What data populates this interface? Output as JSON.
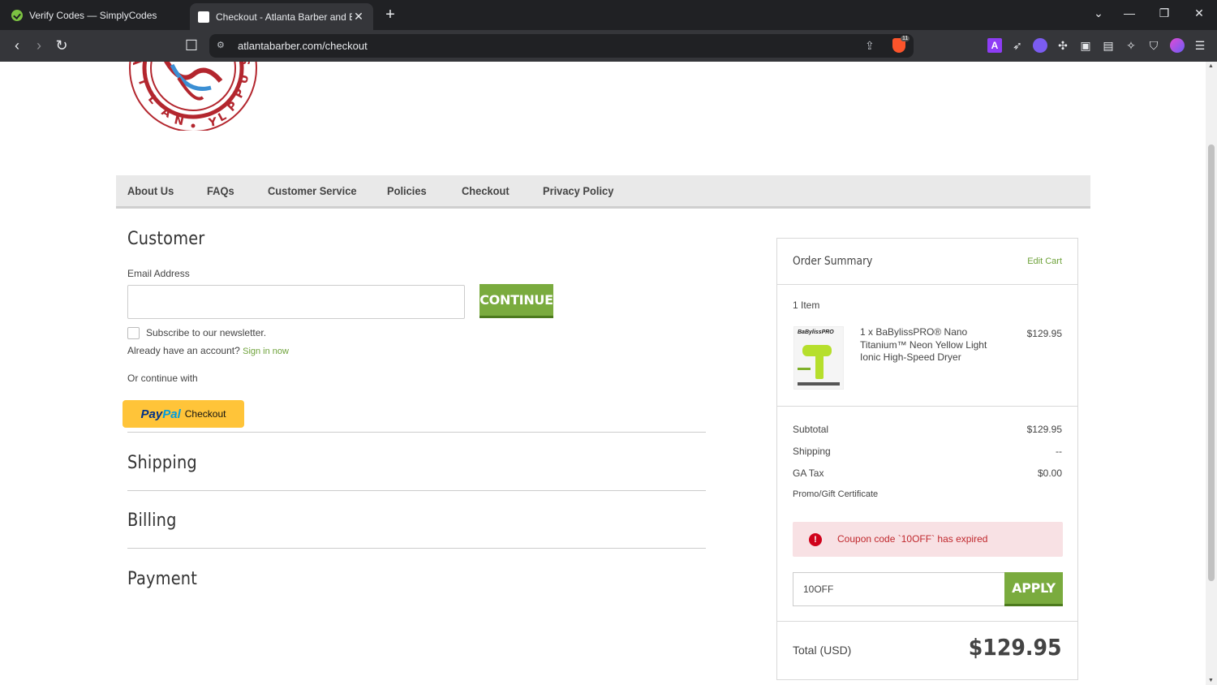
{
  "browser": {
    "tabs": [
      {
        "title": "Verify Codes — SimplyCodes"
      },
      {
        "title": "Checkout - Atlanta Barber and B"
      }
    ],
    "url": "atlantabarber.com/checkout",
    "brave_badge": "11"
  },
  "nav": {
    "items": [
      "About Us",
      "FAQs",
      "Customer Service",
      "Policies",
      "Checkout",
      "Privacy Policy"
    ]
  },
  "customer": {
    "heading": "Customer",
    "email_label": "Email Address",
    "email_value": "",
    "continue_label": "CONTINUE",
    "newsletter_label": "Subscribe to our newsletter.",
    "have_account": "Already have an account?",
    "sign_in": "Sign in now",
    "continue_with": "Or continue with",
    "paypal_text_1": "Pay",
    "paypal_text_2": "Pal",
    "paypal_checkout": "Checkout"
  },
  "sections": {
    "shipping": "Shipping",
    "billing": "Billing",
    "payment": "Payment"
  },
  "summary": {
    "title": "Order Summary",
    "edit_cart": "Edit Cart",
    "item_count": "1 Item",
    "product_name": "1 x BaBylissPRO® Nano Titanium™ Neon Yellow Light Ionic High-Speed Dryer",
    "product_price": "$129.95",
    "product_brand": "BaBylissPRO",
    "subtotal_label": "Subtotal",
    "subtotal_value": "$129.95",
    "shipping_label": "Shipping",
    "shipping_value": "--",
    "tax_label": "GA Tax",
    "tax_value": "$0.00",
    "promo_label": "Promo/Gift Certificate",
    "alert_msg": "Coupon code `10OFF` has expired",
    "coupon_value": "10OFF",
    "apply_label": "APPLY",
    "total_label": "Total (USD)",
    "total_value": "$129.95"
  },
  "colors": {
    "accent_green": "#7aab3e",
    "link_green": "#6ea23a",
    "paypal_yellow": "#ffc439",
    "alert_bg": "#f8e1e4",
    "alert_text": "#c0282d"
  }
}
